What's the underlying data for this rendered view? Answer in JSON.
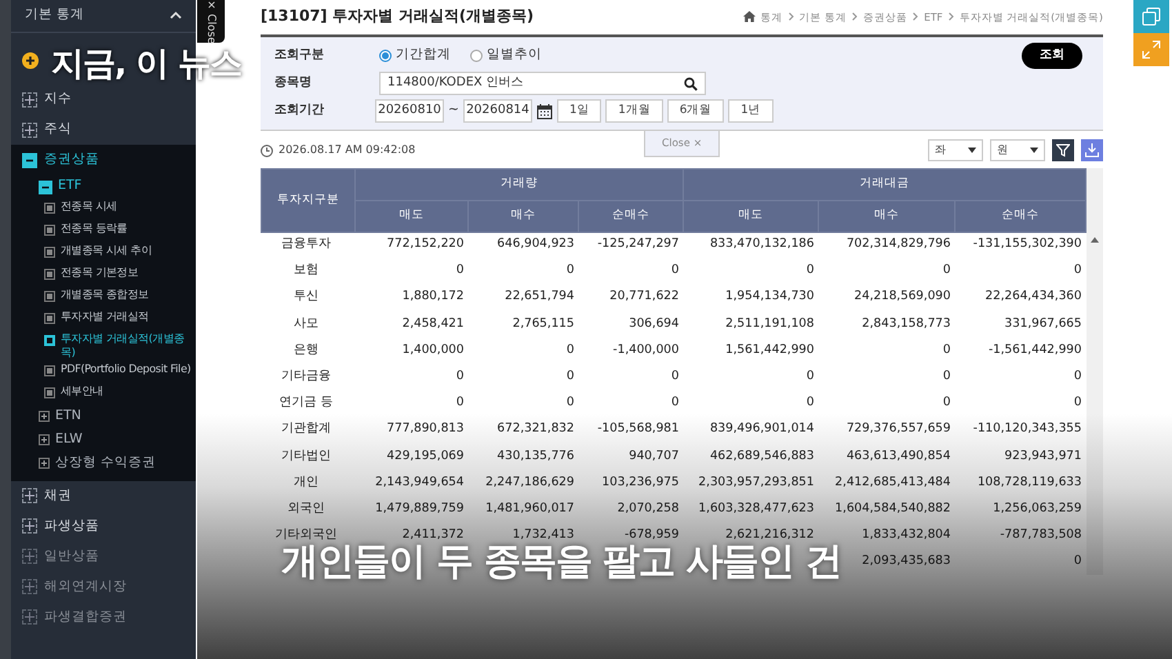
{
  "sidebar": {
    "title": "기본 통계",
    "items": [
      {
        "label": "지수",
        "expanded": false
      },
      {
        "label": "주식",
        "expanded": false
      },
      {
        "label": "증권상품",
        "expanded": true,
        "children": [
          {
            "label": "ETF",
            "expanded": true,
            "children": [
              {
                "label": "전종목 시세",
                "selected": false
              },
              {
                "label": "전종목 등락률",
                "selected": false
              },
              {
                "label": "개별종목 시세 추이",
                "selected": false
              },
              {
                "label": "전종목 기본정보",
                "selected": false
              },
              {
                "label": "개별종목 종합정보",
                "selected": false
              },
              {
                "label": "투자자별 거래실적",
                "selected": false
              },
              {
                "label": "투자자별 거래실적(개별종목)",
                "selected": true
              },
              {
                "label": "PDF(Portfolio Deposit File)",
                "selected": false
              },
              {
                "label": "세부안내",
                "selected": false
              }
            ]
          },
          {
            "label": "ETN",
            "expanded": false
          },
          {
            "label": "ELW",
            "expanded": false
          },
          {
            "label": "상장형 수익증권",
            "expanded": false
          }
        ]
      },
      {
        "label": "채권",
        "expanded": false
      },
      {
        "label": "파생상품",
        "expanded": false
      },
      {
        "label": "일반상품",
        "expanded": false
      },
      {
        "label": "해외연계시장",
        "expanded": false
      },
      {
        "label": "파생결합증권",
        "expanded": false
      }
    ]
  },
  "side_close_tab": {
    "label": "Close",
    "close": "×"
  },
  "headline_overlay": "지금, 이 뉴스",
  "page": {
    "title": "[13107] 투자자별 거래실적(개별종목)",
    "breadcrumb": [
      "통계",
      "기본 통계",
      "증권상품",
      "ETF",
      "투자자별 거래실적(개별종목)"
    ]
  },
  "form": {
    "query_type_label": "조회구분",
    "query_types": [
      {
        "label": "기간합계",
        "selected": true
      },
      {
        "label": "일별추이",
        "selected": false
      }
    ],
    "name_label": "종목명",
    "name_value": "114800/KODEX 인버스",
    "period_label": "조회기간",
    "date_from": "20260810",
    "tilde": "~",
    "date_to": "20260814",
    "period_buttons": [
      "1일",
      "1개월",
      "6개월",
      "1년"
    ],
    "search_button": "조회",
    "close_tab": {
      "label": "Close",
      "close": "×"
    }
  },
  "timestamp": "2026.08.17 AM 09:42:08",
  "selects": [
    "좌",
    "원"
  ],
  "table": {
    "corner": "투자지구분",
    "groups": [
      "거래량",
      "거래대금"
    ],
    "columns": [
      "매도",
      "매수",
      "순매수",
      "매도",
      "매수",
      "순매수"
    ],
    "rows": [
      {
        "label": "금융투자",
        "values": [
          "772,152,220",
          "646,904,923",
          "-125,247,297",
          "833,470,132,186",
          "702,314,829,796",
          "-131,155,302,390"
        ]
      },
      {
        "label": "보험",
        "values": [
          "0",
          "0",
          "0",
          "0",
          "0",
          "0"
        ]
      },
      {
        "label": "투신",
        "values": [
          "1,880,172",
          "22,651,794",
          "20,771,622",
          "1,954,134,730",
          "24,218,569,090",
          "22,264,434,360"
        ]
      },
      {
        "label": "사모",
        "values": [
          "2,458,421",
          "2,765,115",
          "306,694",
          "2,511,191,108",
          "2,843,158,773",
          "331,967,665"
        ]
      },
      {
        "label": "은행",
        "values": [
          "1,400,000",
          "0",
          "-1,400,000",
          "1,561,442,990",
          "0",
          "-1,561,442,990"
        ]
      },
      {
        "label": "기타금융",
        "values": [
          "0",
          "0",
          "0",
          "0",
          "0",
          "0"
        ]
      },
      {
        "label": "연기금 등",
        "values": [
          "0",
          "0",
          "0",
          "0",
          "0",
          "0"
        ]
      },
      {
        "label": "기관합계",
        "values": [
          "777,890,813",
          "672,321,832",
          "-105,568,981",
          "839,496,901,014",
          "729,376,557,659",
          "-110,120,343,355"
        ]
      },
      {
        "label": "기타법인",
        "values": [
          "429,195,069",
          "430,135,776",
          "940,707",
          "462,689,546,883",
          "463,613,490,854",
          "923,943,971"
        ]
      },
      {
        "label": "개인",
        "values": [
          "2,143,949,654",
          "2,247,186,629",
          "103,236,975",
          "2,303,957,293,851",
          "2,412,685,413,484",
          "108,728,119,633"
        ]
      },
      {
        "label": "외국인",
        "values": [
          "1,479,889,759",
          "1,481,960,017",
          "2,070,258",
          "1,603,328,477,623",
          "1,604,584,540,882",
          "1,256,063,259"
        ]
      },
      {
        "label": "기타외국인",
        "values": [
          "2,411,372",
          "1,732,413",
          "-678,959",
          "2,621,216,312",
          "1,833,432,804",
          "-787,783,508"
        ]
      }
    ],
    "partial_row": {
      "last_values": [
        "2,093,435,683",
        "0"
      ]
    }
  },
  "caption": "개인들이 두 종목을 팔고 사들인 건"
}
